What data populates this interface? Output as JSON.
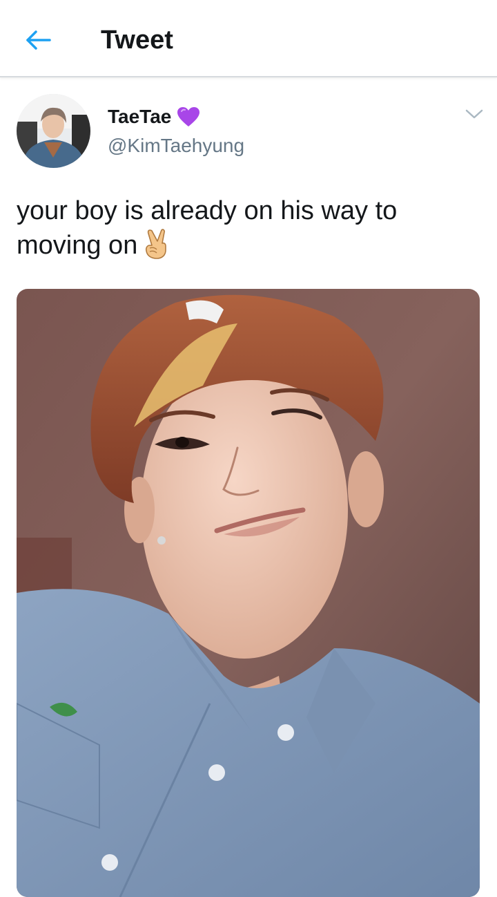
{
  "header": {
    "title": "Tweet",
    "back_icon": "arrow-left-icon",
    "accent_color": "#1da1f2"
  },
  "tweet": {
    "author": {
      "display_name": "TaeTae",
      "badge_icon": "purple-heart-icon",
      "badge_color": "#a846e8",
      "handle": "@KimTaehyung"
    },
    "text": "your boy is already on his way to moving on",
    "text_emoji": "victory-hand-icon",
    "menu_icon": "chevron-down-icon",
    "media_type": "photo"
  }
}
